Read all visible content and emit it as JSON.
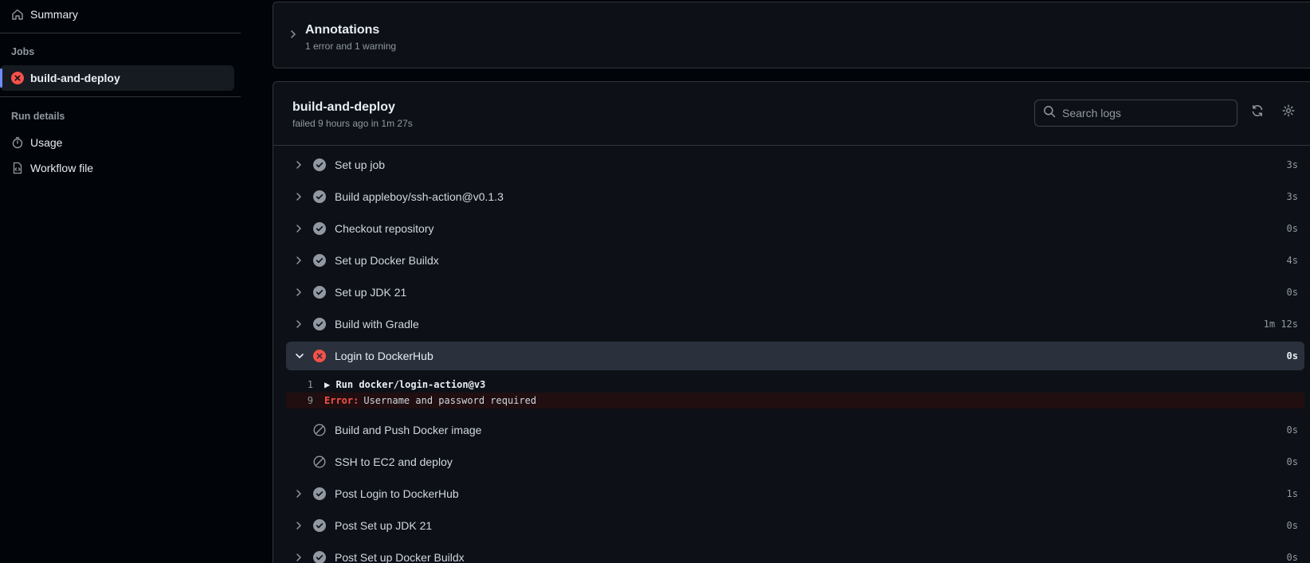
{
  "sidebar": {
    "summary": "Summary",
    "jobs_heading": "Jobs",
    "job_item": "build-and-deploy",
    "run_details_heading": "Run details",
    "usage": "Usage",
    "workflow_file": "Workflow file"
  },
  "annotations": {
    "title": "Annotations",
    "subtitle": "1 error and 1 warning"
  },
  "job": {
    "title": "build-and-deploy",
    "subtitle": "failed 9 hours ago in 1m 27s",
    "search_placeholder": "Search logs"
  },
  "steps": [
    {
      "name": "Set up job",
      "duration": "3s",
      "status": "success"
    },
    {
      "name": "Build appleboy/ssh-action@v0.1.3",
      "duration": "3s",
      "status": "success"
    },
    {
      "name": "Checkout repository",
      "duration": "0s",
      "status": "success"
    },
    {
      "name": "Set up Docker Buildx",
      "duration": "4s",
      "status": "success"
    },
    {
      "name": "Set up JDK 21",
      "duration": "0s",
      "status": "success"
    },
    {
      "name": "Build with Gradle",
      "duration": "1m 12s",
      "status": "success"
    },
    {
      "name": "Login to DockerHub",
      "duration": "0s",
      "status": "failure"
    },
    {
      "name": "Build and Push Docker image",
      "duration": "0s",
      "status": "skipped"
    },
    {
      "name": "SSH to EC2 and deploy",
      "duration": "0s",
      "status": "skipped"
    },
    {
      "name": "Post Login to DockerHub",
      "duration": "1s",
      "status": "success"
    },
    {
      "name": "Post Set up JDK 21",
      "duration": "0s",
      "status": "success"
    },
    {
      "name": "Post Set up Docker Buildx",
      "duration": "0s",
      "status": "success"
    }
  ],
  "log": {
    "line1_no": "1",
    "line1_text": "▶ Run docker/login-action@v3",
    "line2_no": "9",
    "line2_label": "Error:",
    "line2_text": "Username and password required"
  },
  "colors": {
    "success": "#9198a1",
    "failure": "#f85149",
    "accent": "#6f8cff"
  }
}
